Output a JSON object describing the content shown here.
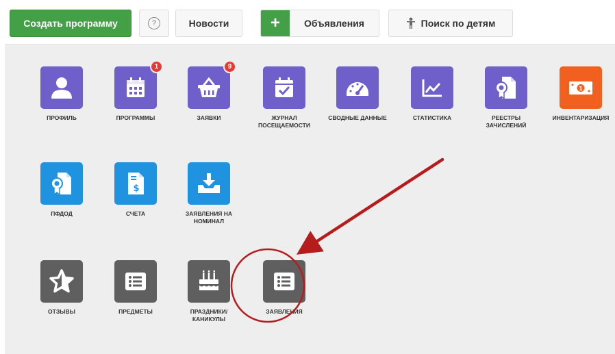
{
  "toolbar": {
    "create_program": "Создать программу",
    "help": "?",
    "news": "Новости",
    "ads_plus": "+",
    "ads": "Объявления",
    "search_children": "Поиск по детям"
  },
  "tiles": {
    "profile": {
      "label": "Профиль",
      "icon": "user-icon"
    },
    "programs": {
      "label": "Программы",
      "icon": "calendar-icon",
      "badge": "1"
    },
    "requests": {
      "label": "Заявки",
      "icon": "basket-icon",
      "badge": "9"
    },
    "attendance": {
      "label": "Журнал посещаемости",
      "icon": "calendar-check-icon"
    },
    "summary": {
      "label": "Сводные данные",
      "icon": "gauge-icon"
    },
    "statistics": {
      "label": "Статистика",
      "icon": "chart-icon"
    },
    "registers": {
      "label": "Реестры зачислений",
      "icon": "certificate-doc-icon"
    },
    "inventory": {
      "label": "Инвентаризация",
      "icon": "banknote-icon"
    },
    "pfdod": {
      "label": "ПФДОД",
      "icon": "certificate-doc-icon"
    },
    "invoices": {
      "label": "Счета",
      "icon": "invoice-icon"
    },
    "nominal": {
      "label": "Заявления на номинал",
      "icon": "inbox-download-icon"
    },
    "reviews": {
      "label": "Отзывы",
      "icon": "star-icon"
    },
    "subjects": {
      "label": "Предметы",
      "icon": "list-icon"
    },
    "holidays": {
      "label": "Праздники/ каникулы",
      "icon": "cake-icon"
    },
    "applications": {
      "label": "Заявления",
      "icon": "list-icon"
    }
  },
  "colors": {
    "green": "#43a047",
    "purple": "#6e5fcb",
    "blue": "#1f92e0",
    "gray": "#5f5f5f",
    "orange": "#f2601f",
    "annotation": "#b71c1c"
  }
}
